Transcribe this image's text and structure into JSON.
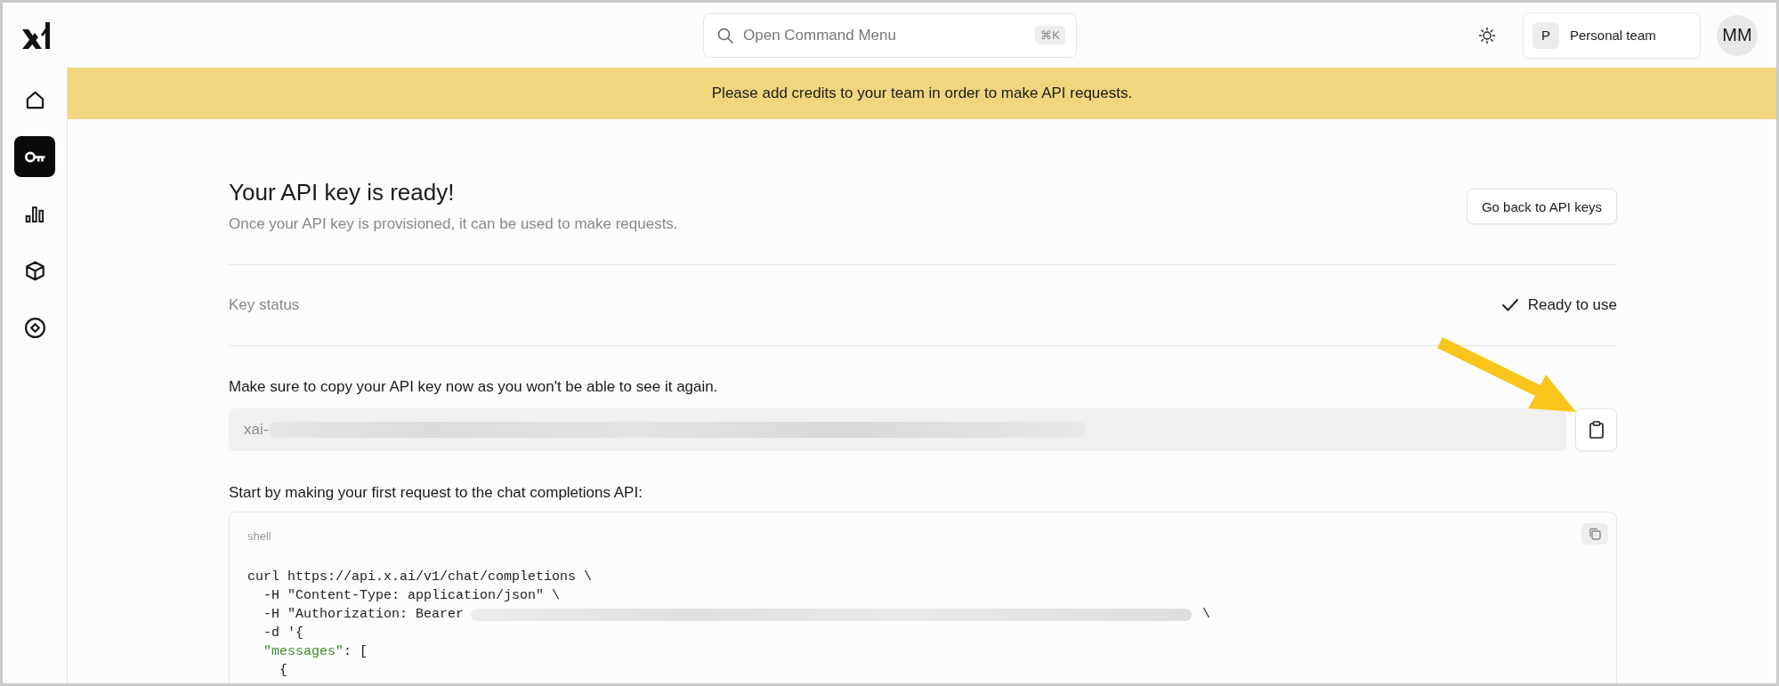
{
  "topbar": {
    "search": {
      "label": "Open Command Menu",
      "shortcut": "⌘K"
    },
    "team": {
      "initial": "P",
      "name": "Personal team"
    },
    "avatar": "MM"
  },
  "sidebar": {
    "items": [
      {
        "selected": false
      },
      {
        "selected": true
      },
      {
        "selected": false
      },
      {
        "selected": false
      },
      {
        "selected": false
      }
    ]
  },
  "banner": "Please add credits to your team in order to make API requests.",
  "header": {
    "title": "Your API key is ready!",
    "subtitle": "Once your API key is provisioned, it can be used to make requests.",
    "button": "Go back to API keys"
  },
  "key_status": {
    "label": "Key status",
    "value": "Ready to use"
  },
  "key": {
    "instruction": "Make sure to copy your API key now as you won't be able to see it again.",
    "prefix": "xai-",
    "redacted": true
  },
  "code": {
    "intro": "Start by making your first request to the chat completions API:",
    "language": "shell",
    "lines": [
      [
        {
          "kind": "plain",
          "text": "curl https://api.x.ai/v1/chat/completions \\"
        }
      ],
      [
        {
          "kind": "plain",
          "text": "  -H \"Content-Type: application/json\" \\"
        }
      ],
      [
        {
          "kind": "plain",
          "text": "  -H \"Authorization: Bearer"
        },
        {
          "kind": "redacted"
        },
        {
          "kind": "plain",
          "text": "\\"
        }
      ],
      [
        {
          "kind": "plain",
          "text": "  -d '{"
        }
      ],
      [
        {
          "kind": "string",
          "text": "  \"messages\""
        },
        {
          "kind": "plain",
          "text": ": ["
        }
      ],
      [
        {
          "kind": "plain",
          "text": "    {"
        }
      ]
    ]
  }
}
